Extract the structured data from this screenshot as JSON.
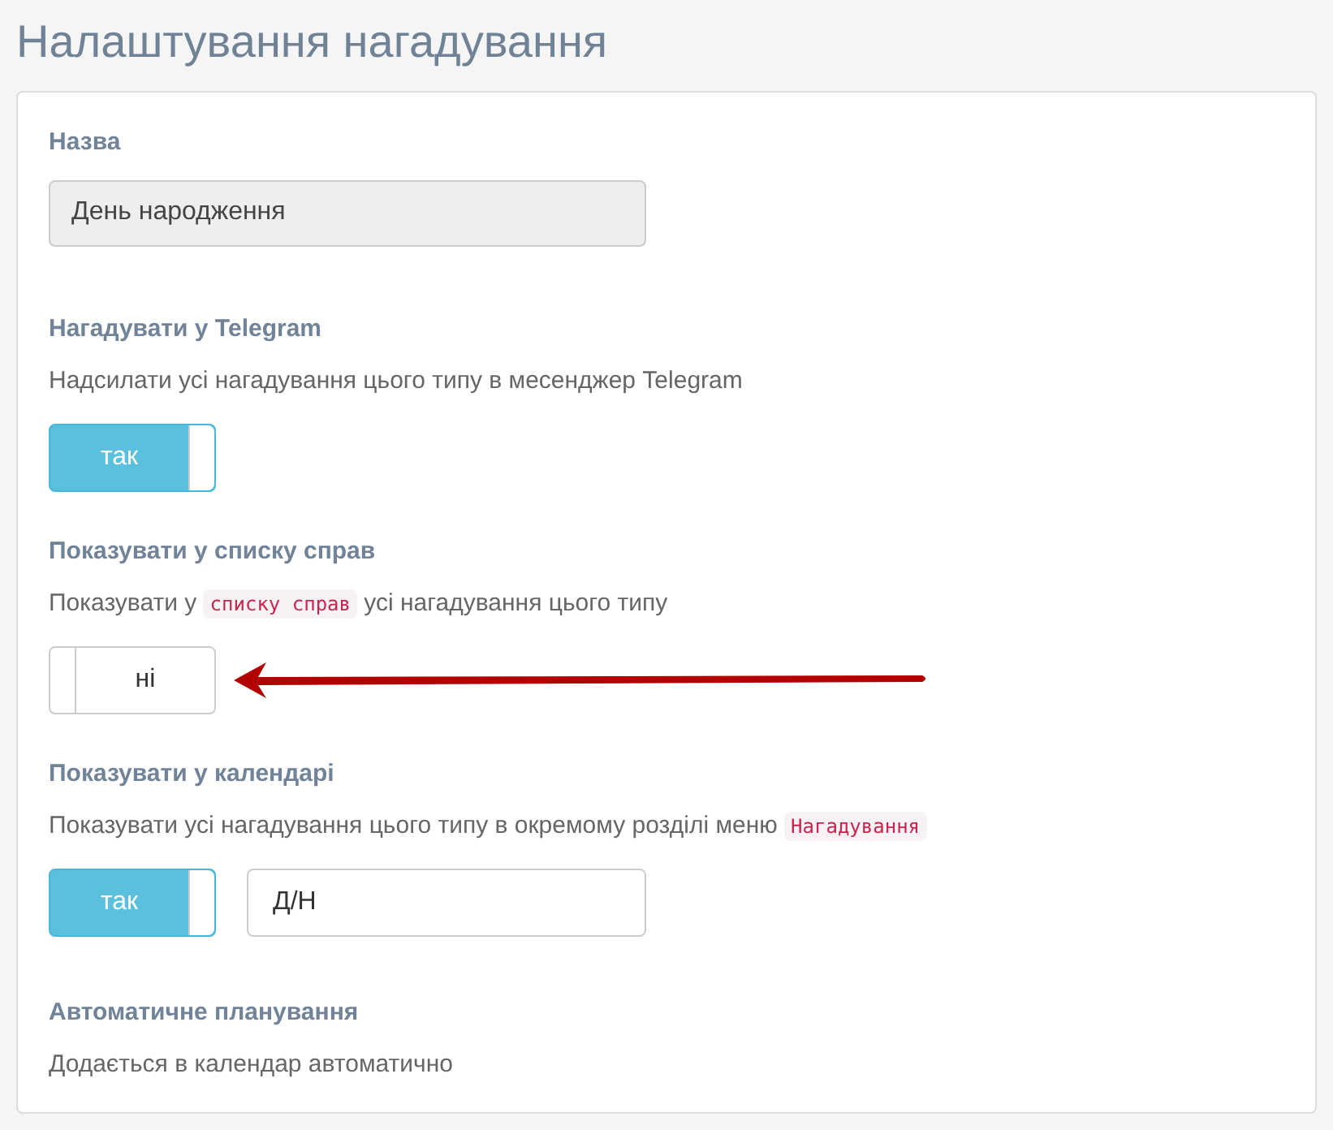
{
  "title": "Налаштування нагадування",
  "name_field": {
    "label": "Назва",
    "value": "День народження",
    "disabled": true
  },
  "sections": [
    {
      "label": "Нагадувати у Telegram",
      "description": [
        {
          "kind": "text",
          "text": "Надсилати усі нагадування цього типу в месенджер Telegram"
        }
      ],
      "toggle": {
        "on": true,
        "label": "так"
      }
    },
    {
      "label": "Показувати у списку справ",
      "description": [
        {
          "kind": "text",
          "text": "Показувати у "
        },
        {
          "kind": "code",
          "text": "списку справ"
        },
        {
          "kind": "text",
          "text": " усі нагадування цього типу"
        }
      ],
      "toggle": {
        "on": false,
        "label": "ні"
      },
      "arrow": true
    },
    {
      "label": "Показувати у календарі",
      "description": [
        {
          "kind": "text",
          "text": "Показувати усі нагадування цього типу в окремому розділі меню "
        },
        {
          "kind": "code",
          "text": "Нагадування"
        }
      ],
      "toggle": {
        "on": true,
        "label": "так"
      },
      "field": {
        "value": "Д/Н"
      }
    },
    {
      "label": "Автоматичне планування",
      "description": [
        {
          "kind": "text",
          "text": "Додається в календар автоматично"
        }
      ]
    }
  ]
}
